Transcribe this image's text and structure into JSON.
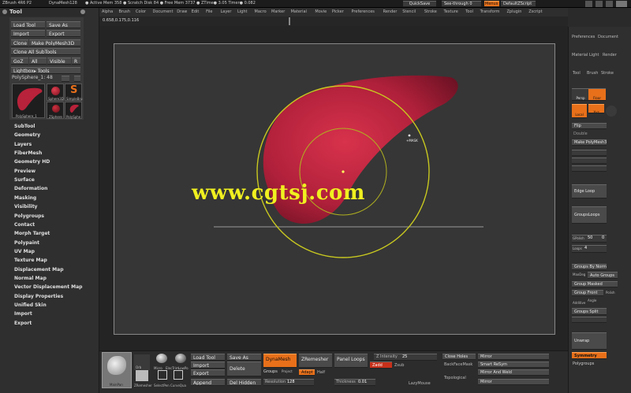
{
  "topbar": {
    "app": "ZBrush 4R6 P2",
    "mesh": "DynaMesh128",
    "stats": "● Active Mem 358  ● Scratch Disk 84  ● Free Mem 3737  ● ZTime● 3.05  Timer● 0.082",
    "quicksave": "QuickSave",
    "see_through": "See-through   0",
    "menus": "Menus",
    "default_zscript": "DefaultZScript"
  },
  "menubar": [
    "Alpha",
    "Brush",
    "Color",
    "Document",
    "Draw",
    "Edit",
    "File",
    "Layer",
    "Light",
    "Macro",
    "Marker",
    "Material",
    "Movie",
    "Picker",
    "Preferences",
    "Render",
    "Stencil",
    "Stroke",
    "Texture",
    "Tool",
    "Transform",
    "Zplugin",
    "Zscript"
  ],
  "coords": "0.658,0.175,0.116",
  "tool_panel": {
    "title": "Tool",
    "load_tool": "Load Tool",
    "save_as": "Save As",
    "import": "Import",
    "export": "Export",
    "clone": "Clone",
    "make_polymesh": "Make PolyMesh3D",
    "clone_all": "Clone All SubTools",
    "goz": "GoZ",
    "all": "All",
    "visible": "Visible",
    "r": "R",
    "lightbox": "Lightbox▸ Tools",
    "current_tool": "PolySphere_1: 48",
    "thumbs": [
      "PolySphere_1",
      "Sphere3D",
      "SimpleBru",
      "ZSphere",
      "PolySphe"
    ]
  },
  "subpalettes": [
    "SubTool",
    "Geometry",
    "Layers",
    "FiberMesh",
    "Geometry HD",
    "Preview",
    "Surface",
    "Deformation",
    "Masking",
    "Visibility",
    "Polygroups",
    "Contact",
    "Morph Target",
    "Polypaint",
    "UV Map",
    "Texture Map",
    "Displacement Map",
    "Normal Map",
    "Vector Displacement Map",
    "Display Properties",
    "Unified Skin",
    "Import",
    "Export"
  ],
  "viewport": {
    "watermark": "www.cgtsj.com",
    "cursor_label": "+MASK"
  },
  "right_menus": {
    "row1": [
      "Preferences",
      "Document"
    ],
    "row2": [
      "Material",
      "Light",
      "Render"
    ],
    "row3": [
      "Tool",
      "Brush",
      "Stroke"
    ]
  },
  "right_shelf": {
    "persp": "Persp",
    "floor": "Floor",
    "local": "Local",
    "xyz": "Xyz",
    "flip": "Flip",
    "double": "Double",
    "make_polymesh": "Make PolyMesh3D",
    "edge_loop": "Edge Loop",
    "group_loops": "GroupsLoops",
    "gpolish": "GPolish",
    "gpolish_val": "50",
    "gpolish_zero": "0",
    "loops": "Loops",
    "loops_val": "4",
    "groups_by_normals": "Groups By Normals",
    "maxdeg": "MaxDeg",
    "auto_groups": "Auto Groups",
    "group_masked": "Group Masked",
    "group_front": "Group Front",
    "polish": "Polish",
    "angle": "Angle",
    "additive": "Additive",
    "groups_split": "Groups Split",
    "unwrap": "Unwrap",
    "symmetry": "Symmetry",
    "polygroups": "Polygroups"
  },
  "bottom": {
    "mainpan": "MainPan",
    "orb": "Orb",
    "micro": "Micro",
    "elec": "ElecTrim",
    "lowpoly": "LowPo",
    "zremesher_icon": "ZRemesher",
    "select_pen": "SelectPen",
    "curve_quad": "CurveQua",
    "load_tool": "Load Tool",
    "save_as": "Save As",
    "import": "Import",
    "delete": "Delete",
    "export": "Export",
    "append": "Append",
    "del_hidden": "Del Hidden",
    "dynamesh": "DynaMesh",
    "groups": "Groups",
    "project": "Project",
    "zremesher": "ZRemesher",
    "adapt": "Adapt",
    "half": "Half",
    "resolution": "Resolution",
    "resolution_val": "128",
    "panel_loops": "Panel Loops",
    "z_intensity": "Z Intensity",
    "z_intensity_val": "25",
    "zadd": "Zadd",
    "zsub": "Zsub",
    "thickness": "Thickness",
    "thickness_val": "0.01",
    "lazymouse": "LazyMouse",
    "close_holes": "Close Holes",
    "backface_mask": "BackFaceMask",
    "topological": "Topological",
    "mirror": "Mirror",
    "smart_resym": "Smart ReSym",
    "mirror_and_weld": "Mirror And Weld",
    "mirror2": "Mirror"
  },
  "colors": {
    "accent": "#e8701a",
    "shape": "#b8223a",
    "ring": "#c8c820",
    "watermark": "#f0f020"
  }
}
